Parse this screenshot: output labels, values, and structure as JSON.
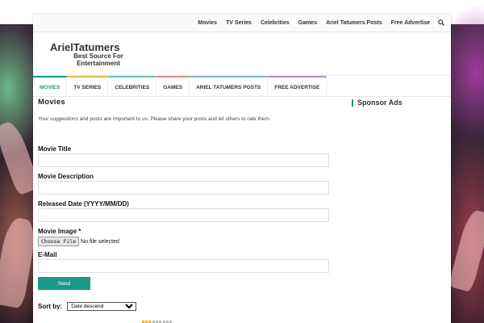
{
  "topbar": {
    "links": [
      "Movies",
      "TV Series",
      "Celebrities",
      "Games",
      "Ariel Tatumers Posts",
      "Free Advertise"
    ],
    "search_icon": "search-icon"
  },
  "header": {
    "site_title": "ArielTatumers",
    "tagline": "Best Source For Entertainment"
  },
  "nav": {
    "items": [
      "MOVIES",
      "TV SERIES",
      "CELEBRITIES",
      "GAMES",
      "ARIEL TATUMERS POSTS",
      "FREE ADVERTISE"
    ],
    "active": "MOVIES"
  },
  "main": {
    "heading": "Movies",
    "intro_em": "Your suggestions",
    "intro_rest": " and posts are important to us. Please share your posts and let others to rate them",
    "form": {
      "title_label": "Movie Title",
      "title_value": "",
      "description_label": "Movie Description",
      "description_value": "",
      "date_label": "Released Date (YYYY/MM/DD)",
      "date_value": "",
      "image_label": "Movie Image *",
      "file_button": "Choose File",
      "file_status": "No file selected",
      "email_label": "E-Mail",
      "email_value": "",
      "send_label": "Send"
    },
    "sort": {
      "label": "Sort by:",
      "selected": "Date descend"
    }
  },
  "sidebar": {
    "title": "Sponsor Ads"
  },
  "colors": {
    "accent": "#1a9a86",
    "active_view": "#f2b41c"
  }
}
